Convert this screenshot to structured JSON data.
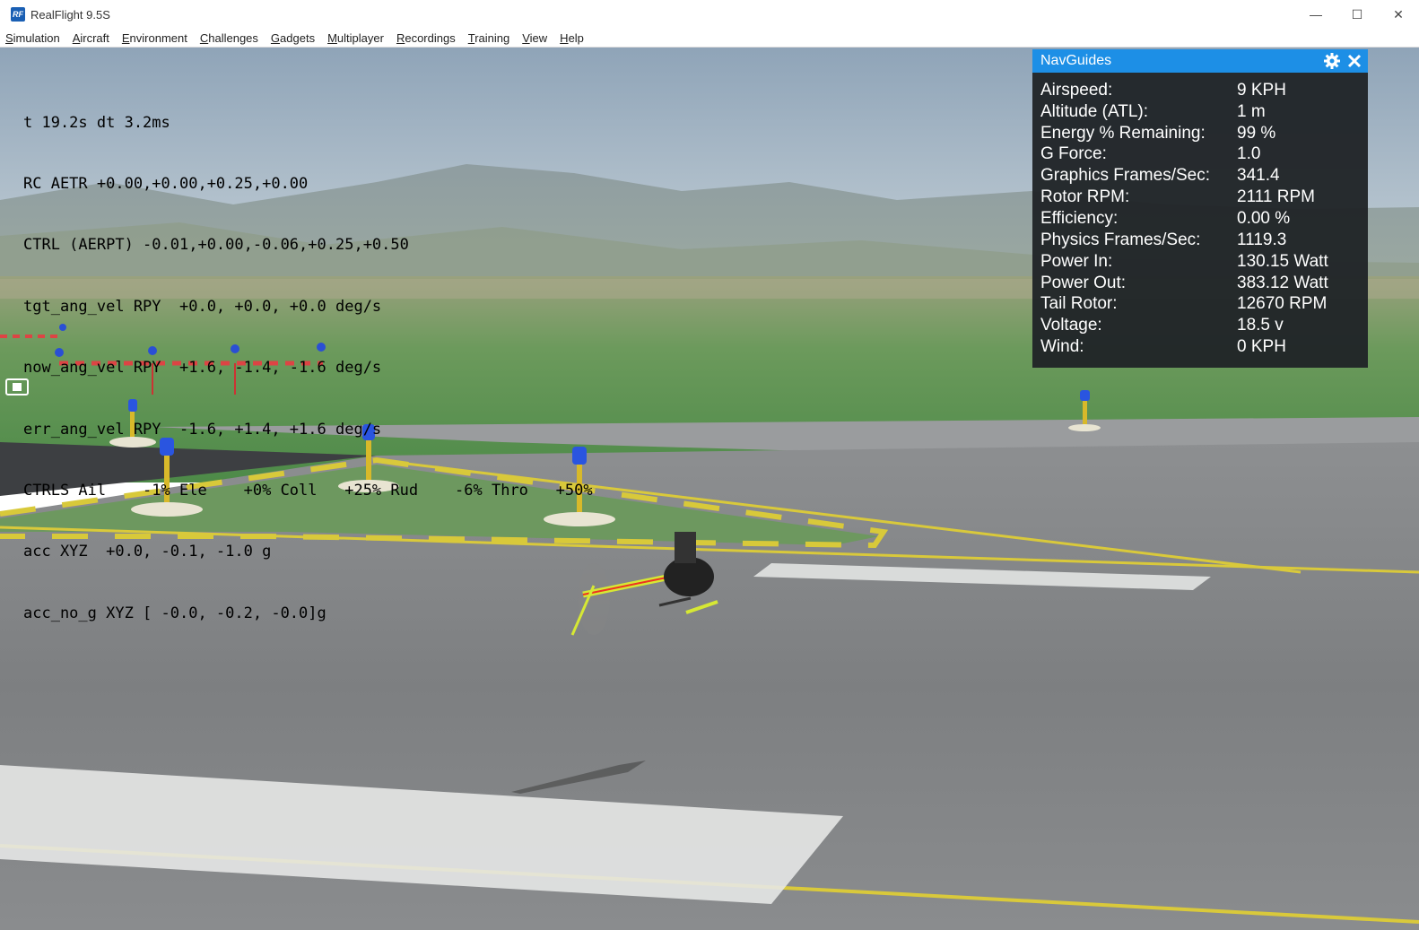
{
  "window": {
    "title": "RealFlight 9.5S",
    "icon_text": "RF",
    "controls": {
      "minimize": "—",
      "maximize": "☐",
      "close": "✕"
    }
  },
  "menu": [
    {
      "accel": "S",
      "rest": "imulation"
    },
    {
      "accel": "A",
      "rest": "ircraft"
    },
    {
      "accel": "E",
      "rest": "nvironment"
    },
    {
      "accel": "C",
      "rest": "hallenges"
    },
    {
      "accel": "G",
      "rest": "adgets"
    },
    {
      "accel": "M",
      "rest": "ultiplayer"
    },
    {
      "accel": "R",
      "rest": "ecordings"
    },
    {
      "accel": "T",
      "rest": "raining"
    },
    {
      "accel": "V",
      "rest": "iew"
    },
    {
      "accel": "H",
      "rest": "elp"
    }
  ],
  "telemetry": [
    "t 19.2s dt 3.2ms",
    "RC AETR +0.00,+0.00,+0.25,+0.00",
    "CTRL (AERPT) -0.01,+0.00,-0.06,+0.25,+0.50",
    "tgt_ang_vel RPY  +0.0, +0.0, +0.0 deg/s",
    "now_ang_vel RPY  +1.6, -1.4, -1.6 deg/s",
    "err_ang_vel RPY  -1.6, +1.4, +1.6 deg/s",
    "CTRLS Ail    -1% Ele    +0% Coll   +25% Rud    -6% Thro   +50%",
    "acc XYZ  +0.0, -0.1, -1.0 g",
    "acc_no_g XYZ [ -0.0, -0.2, -0.0]g"
  ],
  "navguides": {
    "title": "NavGuides",
    "rows": [
      {
        "label": "Airspeed:",
        "value": "9 KPH"
      },
      {
        "label": "Altitude (ATL):",
        "value": "1 m"
      },
      {
        "label": "Energy % Remaining:",
        "value": "99 %"
      },
      {
        "label": "G Force:",
        "value": "1.0"
      },
      {
        "label": "Graphics Frames/Sec:",
        "value": "341.4"
      },
      {
        "label": "Rotor RPM:",
        "value": "2111 RPM"
      },
      {
        "label": "Efficiency:",
        "value": "0.00 %"
      },
      {
        "label": "Physics Frames/Sec:",
        "value": "1119.3"
      },
      {
        "label": "Power In:",
        "value": "130.15 Watt"
      },
      {
        "label": "Power Out:",
        "value": "383.12 Watt"
      },
      {
        "label": "Tail Rotor:",
        "value": "12670 RPM"
      },
      {
        "label": "Voltage:",
        "value": "18.5 v"
      },
      {
        "label": "Wind:",
        "value": "0 KPH"
      }
    ],
    "header_color": "#1d8fe6"
  },
  "icons": [
    "settings-gear-icon",
    "close-icon",
    "camera-view-icon"
  ]
}
